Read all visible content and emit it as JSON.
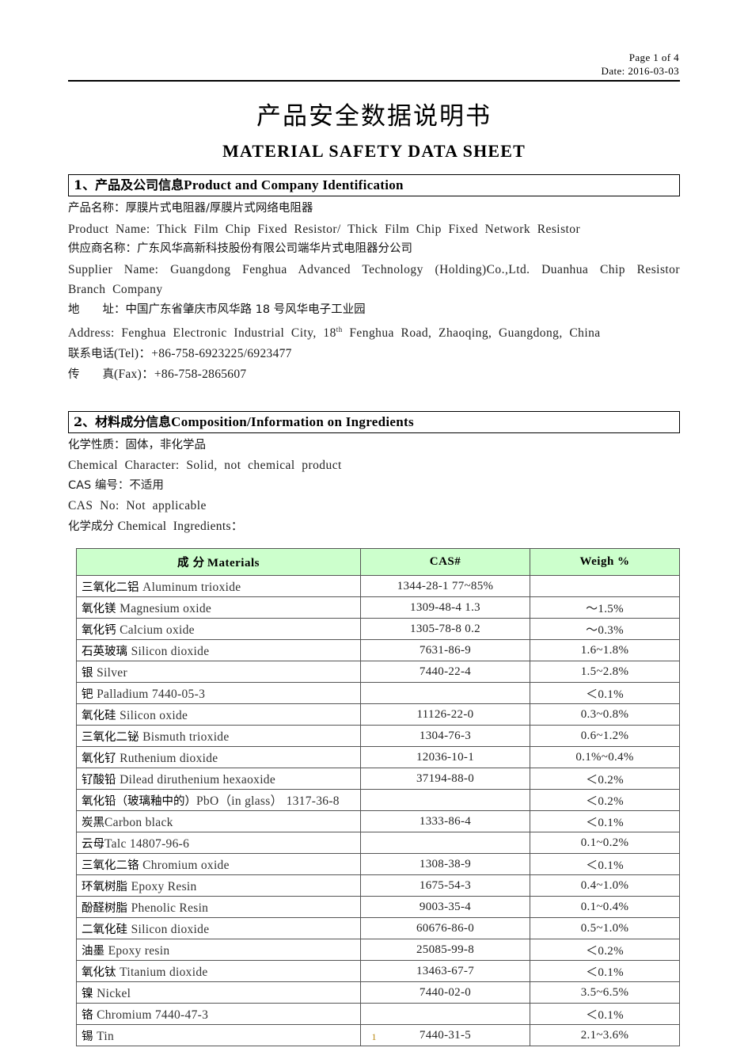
{
  "header": {
    "page_label": "Page  1  of  4",
    "date_label": "Date:  2016-03-03"
  },
  "title": {
    "chinese": "产品安全数据说明书",
    "english": "MATERIAL  SAFETY  DATA  SHEET"
  },
  "section1": {
    "heading_cn": "1、产品及公司信息",
    "heading_en": "Product  and  Company  Identification",
    "lines": [
      {
        "cn": "产品名称：厚膜片式电阻器/厚膜片式网络电阻器"
      },
      {
        "en": "Product  Name:  Thick  Film  Chip  Fixed  Resistor/  Thick  Film  Chip  Fixed  Network  Resistor"
      },
      {
        "cn": "供应商名称：广东风华高新科技股份有限公司端华片式电阻器分公司"
      },
      {
        "en": "Supplier  Name:  Guangdong  Fenghua  Advanced  Technology  (Holding)Co.,Ltd.  Duanhua  Chip  Resistor  Branch  Company"
      },
      {
        "cn": "地　　址：中国广东省肇庆市风华路 18 号风华电子工业园"
      },
      {
        "en_sup": true,
        "en_pre": "Address:  Fenghua  Electronic  Industrial  City,  18",
        "en_sup_text": "th",
        "en_post": "  Fenghua  Road,  Zhaoqing,  Guangdong,  China"
      },
      {
        "mix_cn": "联系电话",
        "mix_ascii": "(Tel)：+86-758-6923225/6923477"
      },
      {
        "mix_cn": "传　　真",
        "mix_ascii": "(Fax)：+86-758-2865607"
      }
    ]
  },
  "section2": {
    "heading_cn": "2、材料成分信息",
    "heading_en": "Composition/Information  on  Ingredients",
    "lines": [
      {
        "cn": "化学性质：固体，非化学品"
      },
      {
        "en": "Chemical  Character:  Solid,  not  chemical  product"
      },
      {
        "mix_cn": "CAS 编号：不适用",
        "mix_ascii": ""
      },
      {
        "en": "CAS  No:  Not  applicable"
      },
      {
        "mix_cn": "化学成分 ",
        "mix_ascii": "Chemical  Ingredients："
      }
    ]
  },
  "table": {
    "columns": [
      {
        "cn": "成 分",
        "en": "Materials"
      },
      {
        "cn": "",
        "en": "CAS#"
      },
      {
        "cn": "",
        "en": "Weigh  %"
      }
    ],
    "rows": [
      {
        "mat_cn": "三氧化二铝 ",
        "mat_en": "Aluminum  trioxide",
        "cas": "1344-28-1  77~85%",
        "wt": ""
      },
      {
        "mat_cn": "氧化镁 ",
        "mat_en": " Magnesium  oxide",
        "cas": "1309-48-4  1.3",
        "wt": "～1.5%"
      },
      {
        "mat_cn": "氧化钙 ",
        "mat_en": " Calcium oxide",
        "cas": "1305-78-8  0.2",
        "wt": "～0.3%"
      },
      {
        "mat_cn": "石英玻璃 ",
        "mat_en": " Silicon dioxide",
        "cas": "7631-86-9",
        "wt": "1.6~1.8%"
      },
      {
        "mat_cn": "银 ",
        "mat_en": " Silver",
        "cas": "7440-22-4",
        "wt": "1.5~2.8%"
      },
      {
        "mat_cn": "钯 ",
        "mat_en": "Palladium  7440-05-3",
        "cas": "",
        "wt": "＜0.1%"
      },
      {
        "mat_cn": "氧化硅 ",
        "mat_en": "Silicon  oxide",
        "cas": "11126-22-0",
        "wt": "0.3~0.8%"
      },
      {
        "mat_cn": "三氧化二铋 ",
        "mat_en": "Bismuth  trioxide",
        "cas": "1304-76-3",
        "wt": "0.6~1.2%"
      },
      {
        "mat_cn": "氧化钌 ",
        "mat_en": "Ruthenium  dioxide",
        "cas": "12036-10-1",
        "wt": "0.1%~0.4%"
      },
      {
        "mat_cn": "钌酸铅 ",
        "mat_en": " Dilead  diruthenium  hexaoxide",
        "cas": "37194-88-0",
        "wt": "＜0.2%"
      },
      {
        "mat_cn": "氧化铅（玻璃釉中的）",
        "mat_en": "PbO（in  glass）  1317-36-8",
        "cas": "",
        "wt": "＜0.2%",
        "overflow": true
      },
      {
        "mat_cn": "炭黑",
        "mat_en": "Carbon  black",
        "cas": "1333-86-4",
        "wt": "＜0.1%"
      },
      {
        "mat_cn": "云母",
        "mat_en": "Talc  14807-96-6",
        "cas": "",
        "wt": "0.1~0.2%"
      },
      {
        "mat_cn": "三氧化二铬 ",
        "mat_en": "Chromium  oxide",
        "cas": "1308-38-9",
        "wt": "＜0.1%"
      },
      {
        "mat_cn": "环氧树脂 ",
        "mat_en": "Epoxy  Resin",
        "cas": "1675-54-3",
        "wt": "0.4~1.0%"
      },
      {
        "mat_cn": "酚醛树脂 ",
        "mat_en": "Phenolic  Resin",
        "cas": "9003-35-4",
        "wt": "0.1~0.4%"
      },
      {
        "mat_cn": "二氧化硅 ",
        "mat_en": " Silicon dioxide",
        "cas": "60676-86-0",
        "wt": "0.5~1.0%"
      },
      {
        "mat_cn": "油墨 ",
        "mat_en": "Epoxy  resin",
        "cas": "25085-99-8",
        "wt": "＜0.2%"
      },
      {
        "mat_cn": "氧化钛 ",
        "mat_en": "Titanium  dioxide",
        "cas": "13463-67-7",
        "wt": "＜0.1%"
      },
      {
        "mat_cn": "镍 ",
        "mat_en": " Nickel",
        "cas": "7440-02-0",
        "wt": "3.5~6.5%"
      },
      {
        "mat_cn": "铬 ",
        "mat_en": "Chromium  7440-47-3",
        "cas": "",
        "wt": "＜0.1%"
      },
      {
        "mat_cn": "锡 ",
        "mat_en": " Tin",
        "cas": "7440-31-5",
        "wt": "2.1~3.6%"
      }
    ]
  },
  "footer": {
    "page_number": "1"
  },
  "colors": {
    "table_header_bg": "#ccffcc",
    "table_border": "#555555",
    "footer_page_number": "#b8860b"
  }
}
